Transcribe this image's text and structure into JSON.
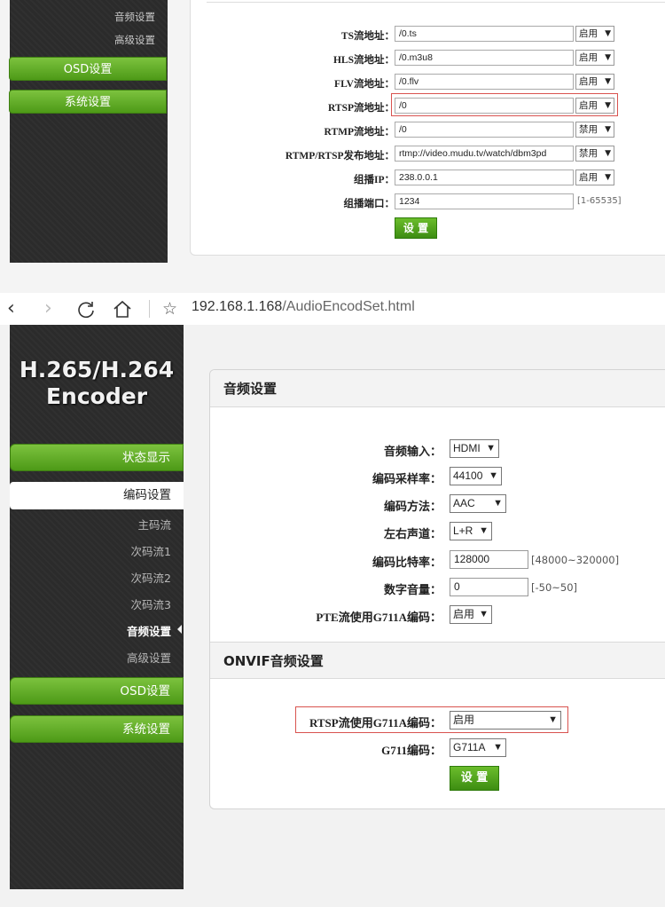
{
  "top": {
    "sidebar": {
      "sub_items": [
        "音频设置",
        "高级设置"
      ],
      "buttons": [
        "OSD设置",
        "系统设置"
      ]
    },
    "rows": [
      {
        "label": "TS流地址：",
        "value": "/0.ts",
        "select": "启用"
      },
      {
        "label": "HLS流地址：",
        "value": "/0.m3u8",
        "select": "启用"
      },
      {
        "label": "FLV流地址：",
        "value": "/0.flv",
        "select": "启用"
      },
      {
        "label": "RTSP流地址：",
        "value": "/0",
        "select": "启用"
      },
      {
        "label": "RTMP流地址：",
        "value": "/0",
        "select": "禁用"
      },
      {
        "label": "RTMP/RTSP发布地址：",
        "value": "rtmp://video.mudu.tv/watch/dbm3pd",
        "select": "禁用"
      },
      {
        "label": "组播IP：",
        "value": "238.0.0.1",
        "select": "启用"
      },
      {
        "label": "组播端口：",
        "value": "1234",
        "range": "[1-65535]"
      }
    ],
    "set_label": "设 置"
  },
  "browser": {
    "host": "192.168.1.168",
    "path": "/AudioEncodSet.html"
  },
  "main": {
    "brand_line1": "H.265/H.264",
    "brand_line2": "Encoder",
    "nav": {
      "status": "状态显示",
      "encode": "编码设置",
      "subs": [
        "主码流",
        "次码流1",
        "次码流2",
        "次码流3",
        "音频设置",
        "高级设置"
      ],
      "osd": "OSD设置",
      "system": "系统设置"
    },
    "audio_section": {
      "title": "音频设置",
      "rows": [
        {
          "label": "音频输入：",
          "value": "HDMI"
        },
        {
          "label": "编码采样率：",
          "value": "44100"
        },
        {
          "label": "编码方法：",
          "value": "AAC"
        },
        {
          "label": "左右声道：",
          "value": "L+R"
        },
        {
          "label": "编码比特率：",
          "value": "128000",
          "range": "[48000~320000]"
        },
        {
          "label": "数字音量：",
          "value": "0",
          "range": "[-50~50]"
        },
        {
          "label": "PTE流使用G711A编码：",
          "value": "启用"
        }
      ]
    },
    "onvif_section": {
      "title": "ONVIF音频设置",
      "rows": [
        {
          "label": "RTSP流使用G711A编码：",
          "value": "启用"
        },
        {
          "label": "G711编码：",
          "value": "G711A"
        }
      ]
    },
    "set_label": "设 置"
  }
}
